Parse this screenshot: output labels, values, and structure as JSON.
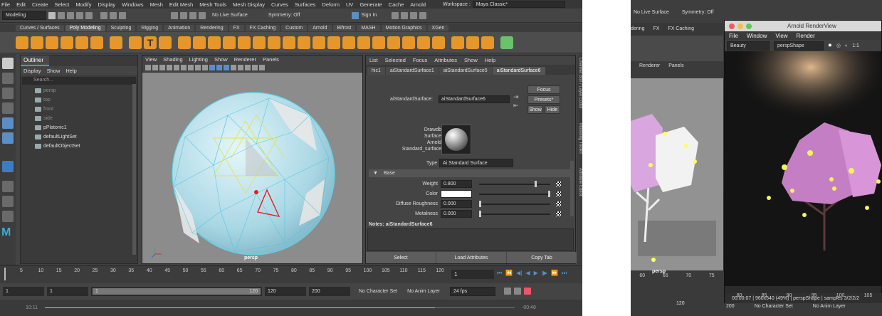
{
  "maya": {
    "menubar": [
      "File",
      "Edit",
      "Create",
      "Select",
      "Modify",
      "Display",
      "Windows",
      "Mesh",
      "Edit Mesh",
      "Mesh Tools",
      "Mesh Display",
      "Curves",
      "Surfaces",
      "Deform",
      "UV",
      "Generate",
      "Cache",
      "Arnold"
    ],
    "workspace_label": "Workspace :",
    "workspace_value": "Maya Classic*",
    "mode": "Modeling",
    "live_surface": "No Live Surface",
    "symmetry": "Symmetry: Off",
    "sign_in": "Sign In",
    "shelf_tabs": [
      "Curves / Surfaces",
      "Poly Modeling",
      "Sculpting",
      "Rigging",
      "Animation",
      "Rendering",
      "FX",
      "FX Caching",
      "Custom",
      "Arnold",
      "Bifrost",
      "MASH",
      "Motion Graphics",
      "XGen"
    ],
    "active_shelf_tab": "Poly Modeling",
    "outliner": {
      "title": "Outliner",
      "menu": [
        "Display",
        "Show",
        "Help"
      ],
      "search_placeholder": "Search...",
      "items": [
        {
          "label": "persp",
          "dim": true
        },
        {
          "label": "top",
          "dim": true
        },
        {
          "label": "front",
          "dim": true
        },
        {
          "label": "side",
          "dim": true
        },
        {
          "label": "pPlatonic1",
          "dim": false
        },
        {
          "label": "defaultLightSet",
          "dim": false
        },
        {
          "label": "defaultObjectSet",
          "dim": false
        }
      ]
    },
    "viewport": {
      "menu": [
        "View",
        "Shading",
        "Lighting",
        "Show",
        "Renderer",
        "Panels"
      ],
      "camera_label": "persp"
    },
    "attr_editor": {
      "menu": [
        "List",
        "Selected",
        "Focus",
        "Attributes",
        "Show",
        "Help"
      ],
      "tabs": [
        "hic1",
        "aiStandardSurface1",
        "aiStandardSurface5",
        "aiStandardSurface6"
      ],
      "active_tab": "aiStandardSurface6",
      "node_label": "aiStandardSurface:",
      "node_value": "aiStandardSurface6",
      "focus_btn": "Focus",
      "presets_btn": "Presets*",
      "show_btn": "Show",
      "hide_btn": "Hide",
      "swatch_label": [
        "Drawdb",
        "Surface",
        "Arnold",
        "Standard_surface"
      ],
      "type_label": "Type",
      "type_value": "Ai Standard Surface",
      "section": "Base",
      "attrs": [
        {
          "label": "Weight",
          "value": "0.800",
          "slider": 0.8
        },
        {
          "label": "Color",
          "value": "",
          "slider": 1.0
        },
        {
          "label": "Diffuse Roughness",
          "value": "0.000",
          "slider": 0.0
        },
        {
          "label": "Metalness",
          "value": "0.000",
          "slider": 0.0
        }
      ],
      "notes": "Notes:  aiStandardSurface6",
      "bottom_buttons": [
        "Select",
        "Load Attributes",
        "Copy Tab"
      ]
    },
    "side_tabs": [
      "Channel Box / Layer Editor",
      "Modeling Toolkit",
      "Attribute Editor"
    ],
    "timeline_ticks": [
      "5",
      "10",
      "15",
      "20",
      "25",
      "30",
      "35",
      "40",
      "45",
      "50",
      "55",
      "60",
      "65",
      "70",
      "75",
      "80",
      "85",
      "90",
      "95",
      "100",
      "105",
      "110",
      "115",
      "120"
    ],
    "current_frame": "1",
    "range": {
      "start": "1",
      "start2": "1",
      "slider_start": "1",
      "slider_end": "120",
      "end": "120",
      "end2": "200",
      "char_set": "No Character Set",
      "anim_layer": "No Anim Layer",
      "fps": "24 fps"
    },
    "playback": {
      "time": "10:11",
      "end": "-00:48"
    }
  },
  "photo": {
    "maya_partial": {
      "live_surface": "No Live Surface",
      "symmetry": "Symmetry: Off",
      "tabs": [
        "dering",
        "FX",
        "FX Caching"
      ],
      "viewport_menu": [
        "Renderer",
        "Panels"
      ],
      "camera": "persp",
      "ticks": [
        "60",
        "65",
        "70",
        "75"
      ],
      "range_value": "120"
    },
    "renderview": {
      "title": "Arnold RenderView",
      "menu": [
        "File",
        "Window",
        "View",
        "Render"
      ],
      "channel": "Beauty",
      "camera": "perspShape",
      "zoom": "1:1",
      "status": "00:00:07 | 960x540 (49%) | perspShape | samples 3/2/2/2",
      "ticks": [
        "80",
        "85",
        "90",
        "95",
        "100",
        "105"
      ],
      "range_value": "200",
      "char_set": "No Character Set",
      "anim_layer": "No Anim Layer"
    }
  }
}
